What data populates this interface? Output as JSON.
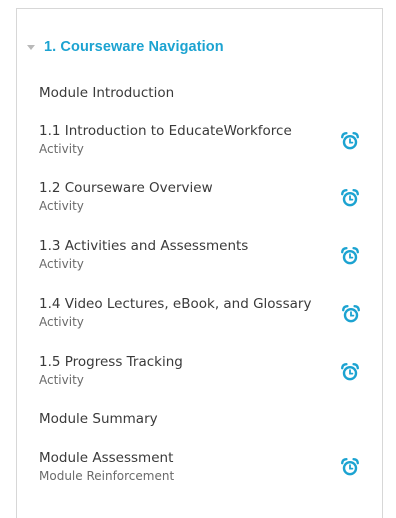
{
  "section": {
    "title": "1. Courseware Navigation",
    "icon": "caret-down-icon",
    "accent_color": "#1ca3d1"
  },
  "items": [
    {
      "title": "Module Introduction",
      "type": "",
      "icon": ""
    },
    {
      "title": "1.1 Introduction to EducateWorkforce",
      "type": "Activity",
      "icon": "alarm-clock-icon"
    },
    {
      "title": "1.2 Courseware Overview",
      "type": "Activity",
      "icon": "alarm-clock-icon"
    },
    {
      "title": "1.3 Activities and Assessments",
      "type": "Activity",
      "icon": "alarm-clock-icon"
    },
    {
      "title": "1.4 Video Lectures, eBook, and Glossary",
      "type": "Activity",
      "icon": "alarm-clock-icon"
    },
    {
      "title": "1.5 Progress Tracking",
      "type": "Activity",
      "icon": "alarm-clock-icon"
    },
    {
      "title": "Module Summary",
      "type": "",
      "icon": ""
    },
    {
      "title": "Module Assessment",
      "type": "Module Reinforcement",
      "icon": "alarm-clock-icon"
    }
  ],
  "colors": {
    "icon": "#1ca3d1",
    "text": "#3a3a3a",
    "subtext": "#6a6a6a"
  }
}
